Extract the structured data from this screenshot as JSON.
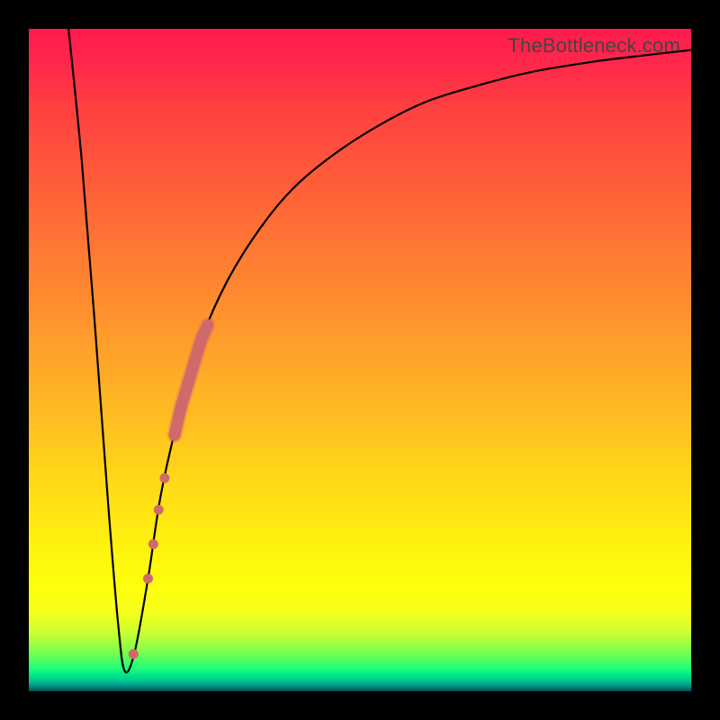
{
  "watermark": "TheBottleneck.com",
  "colors": {
    "frame": "#000000",
    "curve": "#000000",
    "overlay_stroke": "#d06a6a"
  },
  "chart_data": {
    "type": "line",
    "title": "",
    "xlabel": "",
    "ylabel": "",
    "xlim": [
      0,
      100
    ],
    "ylim": [
      0,
      100
    ],
    "series": [
      {
        "name": "bottleneck-curve",
        "x": [
          6,
          8,
          10,
          12,
          13.5,
          14.5,
          16,
          18,
          20,
          23,
          26,
          30,
          35,
          40,
          46,
          53,
          60,
          68,
          76,
          85,
          93,
          100
        ],
        "y": [
          100,
          80,
          55,
          28,
          10,
          3,
          6,
          17,
          30,
          43,
          53,
          62,
          70,
          76,
          81,
          85.5,
          89,
          91.5,
          93.5,
          95,
          96,
          96.8
        ]
      }
    ],
    "annotations": [
      {
        "name": "highlight-segment-upper",
        "on_series": "bottleneck-curve",
        "x_start": 22,
        "x_end": 27,
        "note": "thick salmon overlay on ascending branch"
      },
      {
        "name": "highlight-dots-lower",
        "on_series": "bottleneck-curve",
        "points_x": [
          18.0,
          18.8,
          19.6,
          20.5
        ],
        "note": "dotted salmon overlay just below main segment"
      },
      {
        "name": "highlight-dot-bottom",
        "on_series": "bottleneck-curve",
        "points_x": [
          15.8
        ],
        "note": "single salmon dot near curve minimum"
      }
    ]
  }
}
